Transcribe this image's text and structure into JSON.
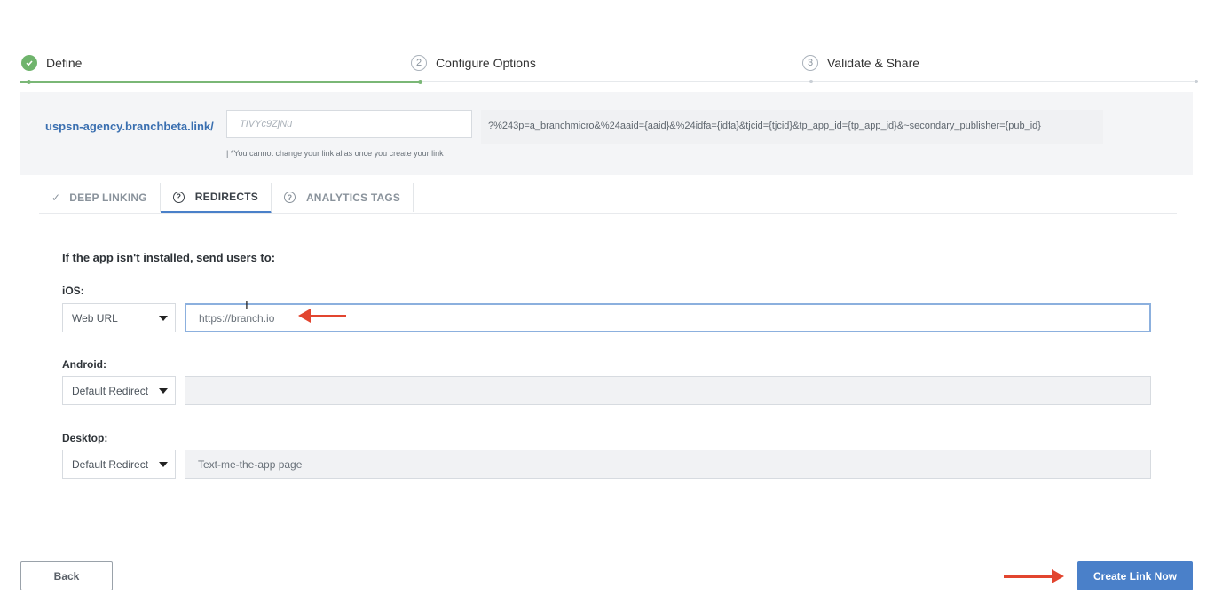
{
  "stepper": {
    "steps": [
      {
        "number": "",
        "label": "Define",
        "status": "done"
      },
      {
        "number": "2",
        "label": "Configure Options",
        "status": "pending"
      },
      {
        "number": "3",
        "label": "Validate & Share",
        "status": "pending"
      }
    ]
  },
  "link": {
    "domain": "uspsn-agency.branchbeta.link/",
    "alias_placeholder": "TIVYc9ZjNu",
    "alias_note": "| *You cannot change your link alias once you create your link",
    "query": "?%243p=a_branchmicro&%24aaid={aaid}&%24idfa={idfa}&tjcid={tjcid}&tp_app_id={tp_app_id}&~secondary_publisher={pub_id}"
  },
  "tabs": [
    {
      "label": "DEEP LINKING",
      "icon": "check-icon",
      "active": false
    },
    {
      "label": "REDIRECTS",
      "icon": "question-icon",
      "active": true
    },
    {
      "label": "ANALYTICS TAGS",
      "icon": "question-icon",
      "active": false
    }
  ],
  "form": {
    "heading": "If the app isn't installed, send users to:",
    "ios": {
      "label": "iOS:",
      "select": "Web URL",
      "value": "https://branch.io"
    },
    "android": {
      "label": "Android:",
      "select": "Default Redirect",
      "value": ""
    },
    "desktop": {
      "label": "Desktop:",
      "select": "Default Redirect",
      "value": "Text-me-the-app page"
    }
  },
  "buttons": {
    "back": "Back",
    "create": "Create Link Now"
  },
  "colors": {
    "accent": "#4a80c9",
    "done": "#6fb46c",
    "annotation_arrow": "#e2452f"
  }
}
